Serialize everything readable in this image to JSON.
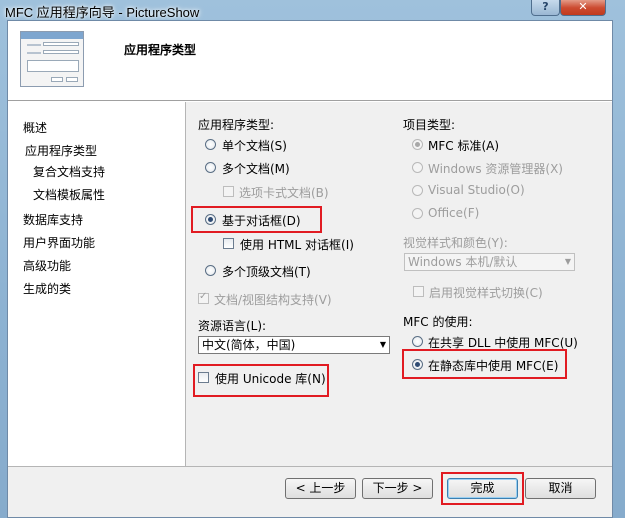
{
  "window": {
    "title": "MFC 应用程序向导 - PictureShow",
    "help_glyph": "?",
    "close_glyph": "✕"
  },
  "header": {
    "page_title": "应用程序类型"
  },
  "nav": {
    "items": [
      "概述",
      "应用程序类型",
      "复合文档支持",
      "文档模板属性",
      "数据库支持",
      "用户界面功能",
      "高级功能",
      "生成的类"
    ]
  },
  "app_type": {
    "label": "应用程序类型:",
    "single_doc": "单个文档(S)",
    "multi_doc": "多个文档(M)",
    "tabbed_docs": "选项卡式文档(B)",
    "dialog_based": "基于对话框(D)",
    "use_html_dialog": "使用 HTML 对话框(I)",
    "multi_top_level": "多个顶级文档(T)",
    "doc_view_support": "文档/视图结构支持(V)",
    "selected": "dialog_based"
  },
  "resource_lang": {
    "label": "资源语言(L):",
    "value": "中文(简体，中国)"
  },
  "unicode": {
    "label": "使用 Unicode 库(N)",
    "checked": false
  },
  "project_type": {
    "label": "项目类型:",
    "mfc_standard": "MFC 标准(A)",
    "explorer": "Windows 资源管理器(X)",
    "visual_studio": "Visual Studio(O)",
    "office": "Office(F)",
    "selected": "mfc_standard"
  },
  "visual_style": {
    "label": "视觉样式和颜色(Y):",
    "value": "Windows 本机/默认",
    "toggle_label": "启用视觉样式切换(C)"
  },
  "mfc_use": {
    "label": "MFC 的使用:",
    "shared_dll": "在共享 DLL 中使用 MFC(U)",
    "static_lib": "在静态库中使用 MFC(E)",
    "selected": "static_lib"
  },
  "buttons": {
    "prev": "< 上一步",
    "next": "下一步 >",
    "finish": "完成",
    "cancel": "取消"
  },
  "colors": {
    "highlight_box": "#e11b22"
  }
}
